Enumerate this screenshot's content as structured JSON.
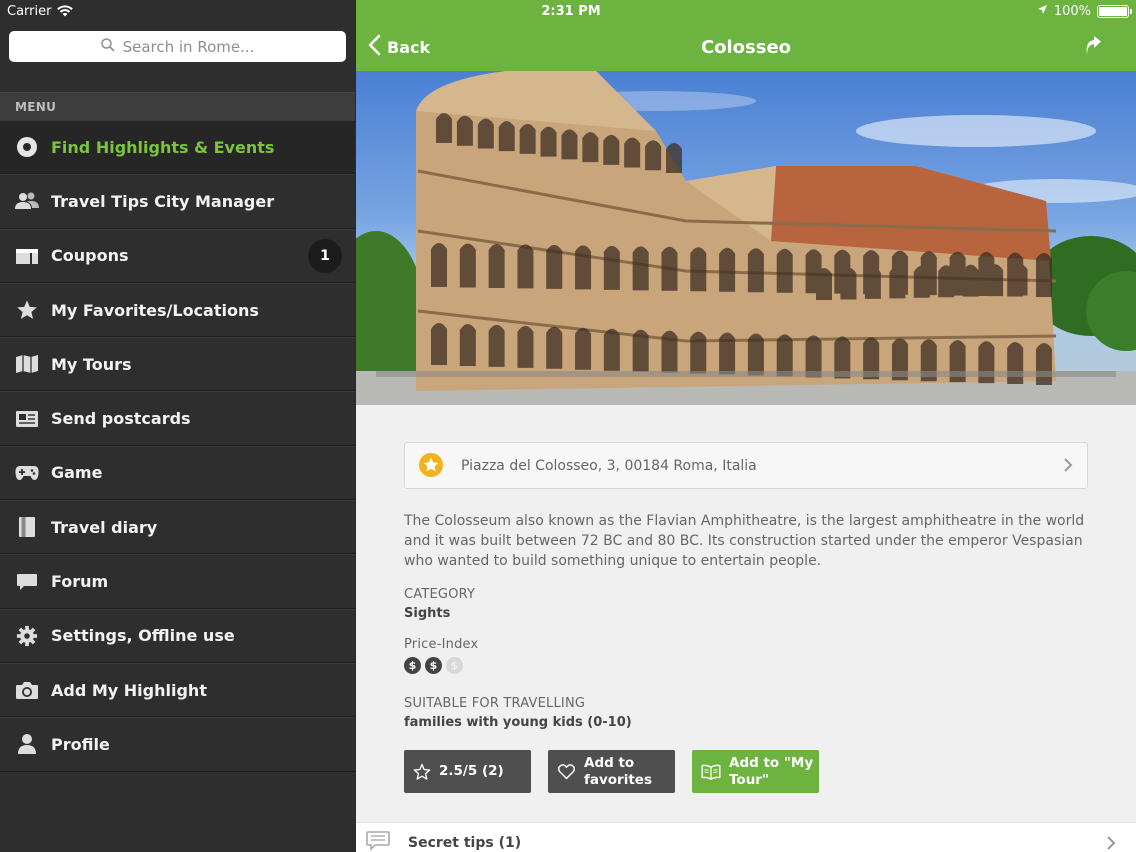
{
  "sidebar": {
    "carrier": "Carrier",
    "search_placeholder": "Search in Rome...",
    "menu_header": "MENU",
    "items": [
      {
        "label": "Find Highlights & Events",
        "icon": "target-icon"
      },
      {
        "label": "Travel Tips City Manager",
        "icon": "users-icon"
      },
      {
        "label": "Coupons",
        "icon": "coupon-icon",
        "badge": "1"
      },
      {
        "label": "My Favorites/Locations",
        "icon": "star-icon"
      },
      {
        "label": "My Tours",
        "icon": "map-icon"
      },
      {
        "label": "Send postcards",
        "icon": "postcard-icon"
      },
      {
        "label": "Game",
        "icon": "gamepad-icon"
      },
      {
        "label": "Travel diary",
        "icon": "diary-icon"
      },
      {
        "label": "Forum",
        "icon": "chat-icon"
      },
      {
        "label": "Settings, Offline use",
        "icon": "gear-icon"
      },
      {
        "label": "Add My Highlight",
        "icon": "camera-icon"
      },
      {
        "label": "Profile",
        "icon": "profile-icon"
      }
    ]
  },
  "status": {
    "time": "2:31 PM",
    "battery": "100%",
    "battery_level": 1.0
  },
  "nav": {
    "back_label": "Back",
    "title": "Colosseo"
  },
  "detail": {
    "address": "Piazza del Colosseo, 3, 00184 Roma, Italia",
    "description": "The Colosseum also known as the Flavian Amphitheatre, is the largest amphitheatre in the world and it was built between 72 BC and 80 BC. Its construction started under the emperor Vespasian who wanted to build something unique to entertain people.",
    "category_label": "CATEGORY",
    "category_value": "Sights",
    "price_label": "Price-Index",
    "price_symbol": "$",
    "price_level": 2,
    "price_max": 3,
    "suitable_label": "SUITABLE FOR TRAVELLING",
    "suitable_value": "families with young kids (0-10)"
  },
  "buttons": {
    "rating": "2.5/5 (2)",
    "favorites": "Add to favorites",
    "tour": "Add to \"My Tour\""
  },
  "secret_tips": "Secret tips (1)",
  "colors": {
    "accent": "#6cb33f",
    "sidebar_bg": "#2e2e2e",
    "dark_button": "#4f4f4f"
  }
}
